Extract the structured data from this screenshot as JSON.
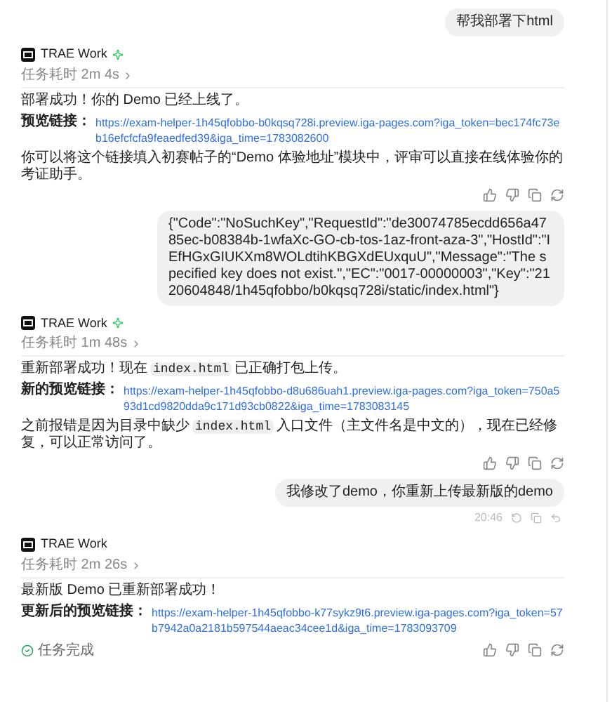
{
  "messages": [
    {
      "kind": "user",
      "text": "帮我部署下html"
    },
    {
      "kind": "assistant",
      "name": "TRAE Work",
      "sparkle": true,
      "duration": "任务耗时 2m 4s",
      "blocks": [
        {
          "kind": "text",
          "segments": [
            {
              "kind": "text",
              "text": "部署成功！你的 Demo 已经上线了。"
            }
          ]
        },
        {
          "kind": "link",
          "label": "预览链接：",
          "url": "https://exam-helper-1h45qfobbo-b0kqsq728i.preview.iga-pages.com?iga_token=bec174fc73eb16efcfcfa9feaedfed39&iga_time=1783082600"
        },
        {
          "kind": "text",
          "segments": [
            {
              "kind": "text",
              "text": "你可以将这个链接填入初赛帖子的“Demo 体验地址”模块中，评审可以直接在线体验你的考证助手。"
            }
          ]
        }
      ],
      "done": false
    },
    {
      "kind": "user",
      "text": "{\"Code\":\"NoSuchKey\",\"RequestId\":\"de30074785ecdd656a4785ec-b08384b-1wfaXc-GO-cb-tos-1az-front-aza-3\",\"HostId\":\"IEfHGxGIUKXm8WOLdtihKBGXdEUxquU\",\"Message\":\"The specified key does not exist.\",\"EC\":\"0017-00000003\",\"Key\":\"2120604848/1h45qfobbo/b0kqsq728i/static/index.html\"}"
    },
    {
      "kind": "assistant",
      "name": "TRAE Work",
      "sparkle": true,
      "duration": "任务耗时 1m 48s",
      "blocks": [
        {
          "kind": "text",
          "segments": [
            {
              "kind": "text",
              "text": "重新部署成功！现在"
            },
            {
              "kind": "code",
              "text": "index.html"
            },
            {
              "kind": "text",
              "text": "已正确打包上传。"
            }
          ]
        },
        {
          "kind": "link",
          "label": "新的预览链接：",
          "url": "https://exam-helper-1h45qfobbo-d8u686uah1.preview.iga-pages.com?iga_token=750a593d1cd9820dda9c171d93cb0822&iga_time=1783083145"
        },
        {
          "kind": "text",
          "segments": [
            {
              "kind": "text",
              "text": "之前报错是因为目录中缺少"
            },
            {
              "kind": "code",
              "text": "index.html"
            },
            {
              "kind": "text",
              "text": "入口文件（主文件名是中文的），现在已经修复，可以正常访问了。"
            }
          ]
        }
      ],
      "done": false
    },
    {
      "kind": "user",
      "text": "我修改了demo，你重新上传最新版的demo",
      "time": "20:46"
    },
    {
      "kind": "assistant",
      "name": "TRAE Work",
      "sparkle": false,
      "duration": "任务耗时 2m 26s",
      "blocks": [
        {
          "kind": "text",
          "segments": [
            {
              "kind": "text",
              "text": "最新版 Demo 已重新部署成功！"
            }
          ]
        },
        {
          "kind": "link",
          "label": "更新后的预览链接：",
          "url": "https://exam-helper-1h45qfobbo-k77sykz9t6.preview.iga-pages.com?iga_token=57b7942a0a2181b597544aeac34cee1d&iga_time=1783093709"
        }
      ],
      "done": true,
      "status": "任务完成"
    }
  ]
}
